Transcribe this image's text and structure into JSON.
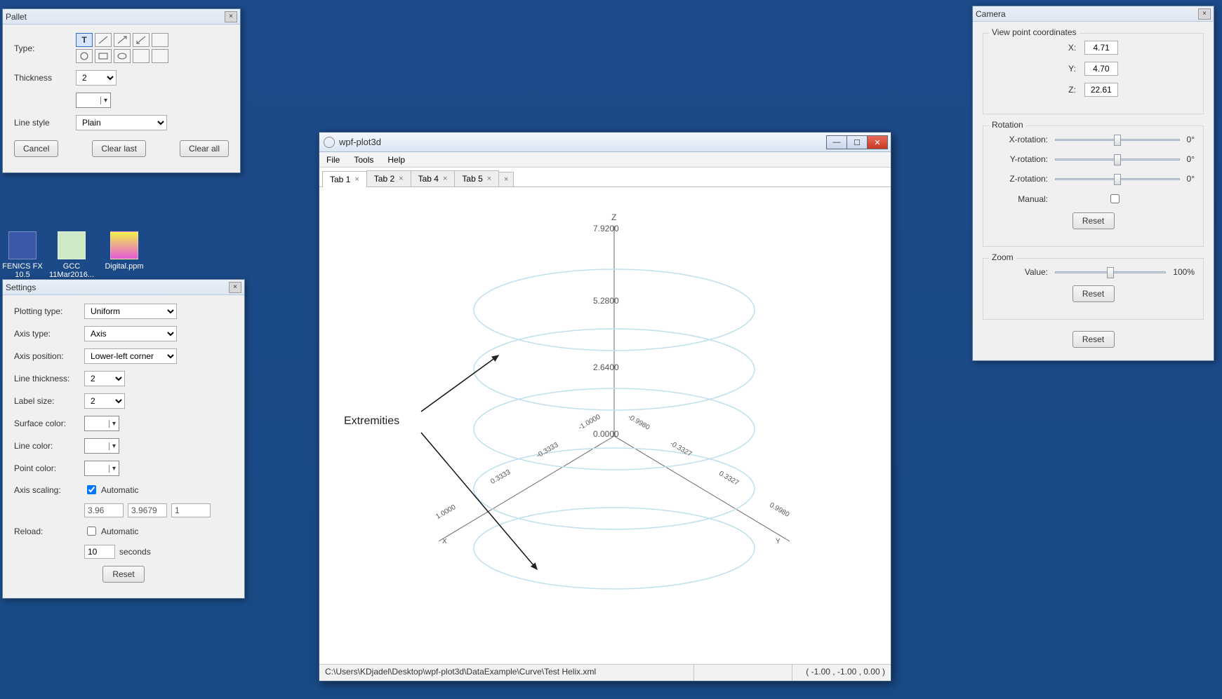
{
  "desktop_icons": [
    {
      "label": "FENICS FX 10.5"
    },
    {
      "label": "GCC 11Mar2016..."
    },
    {
      "label": "Digital.ppm"
    }
  ],
  "pallet": {
    "title": "Pallet",
    "type_label": "Type:",
    "thickness_label": "Thickness",
    "thickness_value": "2",
    "linestyle_label": "Line style",
    "linestyle_value": "Plain",
    "cancel": "Cancel",
    "clear_last": "Clear last",
    "clear_all": "Clear all",
    "tool_glyph": "T"
  },
  "settings": {
    "title": "Settings",
    "plotting_type_label": "Plotting type:",
    "plotting_type_value": "Uniform",
    "axis_type_label": "Axis type:",
    "axis_type_value": "Axis",
    "axis_position_label": "Axis position:",
    "axis_position_value": "Lower-left corner",
    "line_thickness_label": "Line thickness:",
    "line_thickness_value": "2",
    "label_size_label": "Label size:",
    "label_size_value": "2",
    "surface_color_label": "Surface color:",
    "surface_color": "#e8a24a",
    "line_color_label": "Line color:",
    "line_color": "#b9daeb",
    "point_color_label": "Point color:",
    "point_color": "#d8897a",
    "axis_scaling_label": "Axis scaling:",
    "axis_scaling_auto_label": "Automatic",
    "scale_x": "3.96",
    "scale_y": "3.9679",
    "scale_z": "1",
    "reload_label": "Reload:",
    "reload_auto_label": "Automatic",
    "reload_interval": "10",
    "reload_units": "seconds",
    "reset": "Reset"
  },
  "app": {
    "title": "wpf-plot3d",
    "menu": {
      "file": "File",
      "tools": "Tools",
      "help": "Help"
    },
    "tabs": [
      {
        "label": "Tab 1",
        "active": true
      },
      {
        "label": "Tab 2",
        "active": false
      },
      {
        "label": "Tab 4",
        "active": false
      },
      {
        "label": "Tab 5",
        "active": false
      }
    ],
    "extra_tab_close": "×",
    "annotation": "Extremities",
    "z_axis_label": "Z",
    "z_ticks": [
      "7.9200",
      "5.2800",
      "2.6400",
      "0.0000"
    ],
    "xy_ticks_left": [
      "-1.0000",
      "-0.3333",
      "0.3333",
      "1.0000"
    ],
    "xy_ticks_right": [
      "-0.9980",
      "-0.3327",
      "0.3327",
      "0.9980"
    ],
    "x_end": "X",
    "y_end": "Y",
    "status_path": "C:\\Users\\KDjadel\\Desktop\\wpf-plot3d\\DataExample\\Curve\\Test Helix.xml",
    "status_coords": "( -1.00 , -1.00 , 0.00 )"
  },
  "camera": {
    "title": "Camera",
    "viewpoint_label": "View point coordinates",
    "x_label": "X:",
    "x_val": "4.71",
    "y_label": "Y:",
    "y_val": "4.70",
    "z_label": "Z:",
    "z_val": "22.61",
    "rotation_label": "Rotation",
    "xrot_label": "X-rotation:",
    "xrot_val": "0°",
    "yrot_label": "Y-rotation:",
    "yrot_val": "0°",
    "zrot_label": "Z-rotation:",
    "zrot_val": "0°",
    "manual_label": "Manual:",
    "zoom_label": "Zoom",
    "zoom_value_label": "Value:",
    "zoom_val": "100%",
    "reset": "Reset"
  }
}
